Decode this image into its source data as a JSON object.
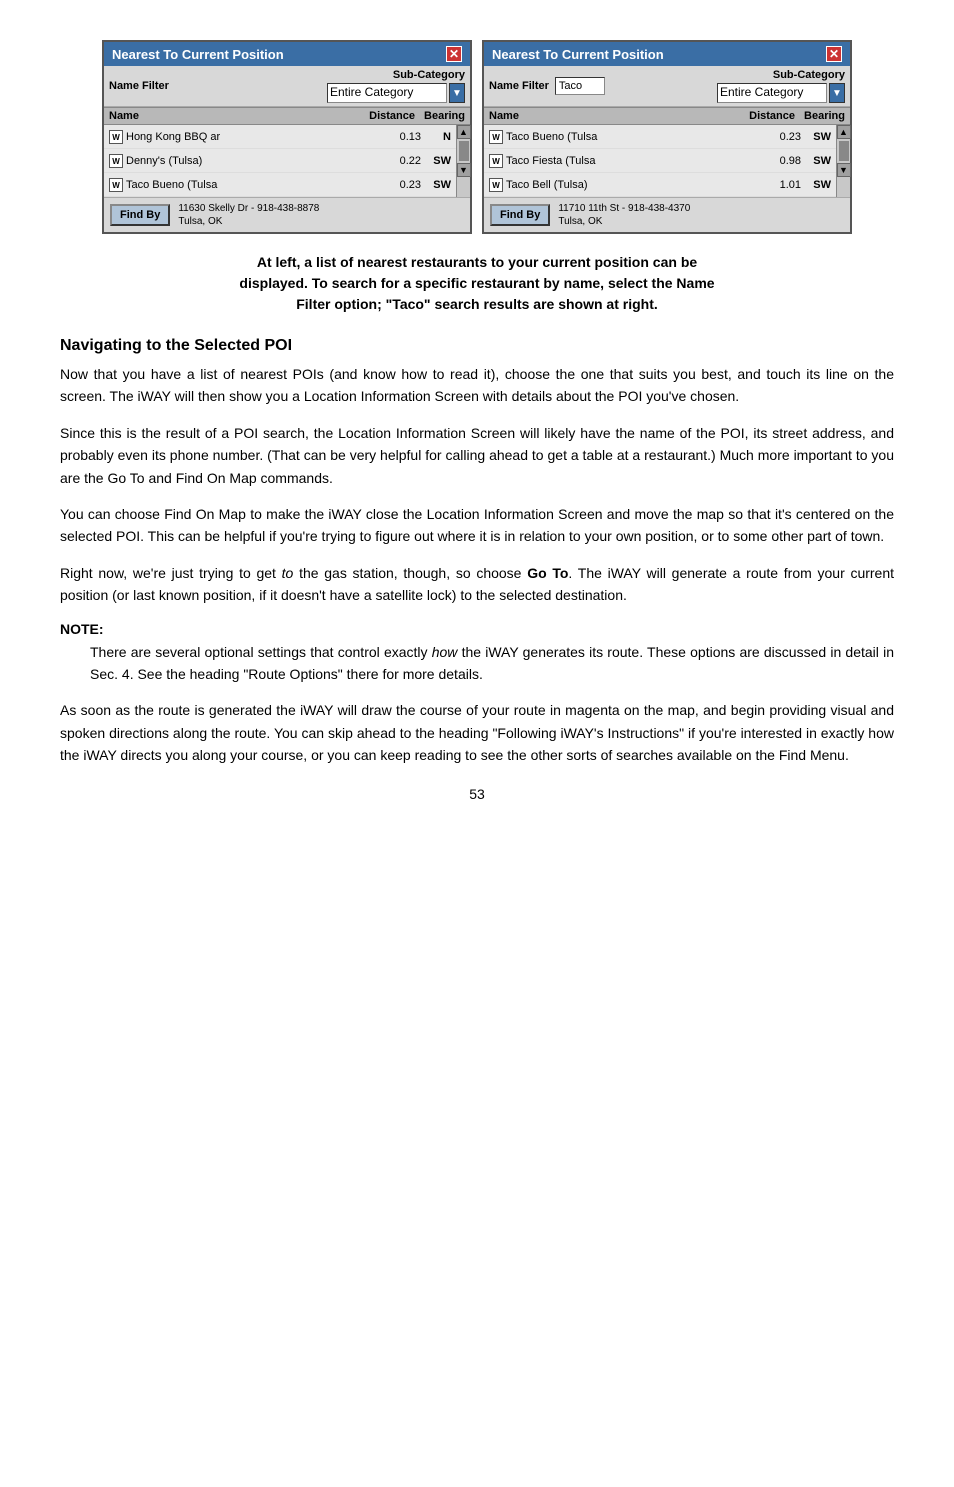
{
  "screenshots": [
    {
      "id": "left",
      "titlebar": "Nearest To Current Position",
      "close_label": "✕",
      "name_filter_label": "Name Filter",
      "name_filter_value": "",
      "subcategory_label": "Sub-Category",
      "subcategory_value": "Entire Category",
      "col_name": "Name",
      "col_distance": "Distance",
      "col_bearing": "Bearing",
      "items": [
        {
          "icon": "W",
          "name": "Hong Kong BBQ ar",
          "dist": "0.13",
          "bearing": "N"
        },
        {
          "icon": "W",
          "name": "Denny's (Tulsa)",
          "dist": "0.22",
          "bearing": "SW"
        },
        {
          "icon": "W",
          "name": "Taco Bueno (Tulsa",
          "dist": "0.23",
          "bearing": "SW"
        }
      ],
      "findby_label": "Find By",
      "address_line1": "11630 Skelly Dr - 918-438-8878",
      "address_line2": "Tulsa, OK"
    },
    {
      "id": "right",
      "titlebar": "Nearest To Current Position",
      "close_label": "✕",
      "name_filter_label": "Name Filter",
      "name_filter_value": "Taco",
      "subcategory_label": "Sub-Category",
      "subcategory_value": "Entire Category",
      "col_name": "Name",
      "col_distance": "Distance",
      "col_bearing": "Bearing",
      "items": [
        {
          "icon": "W",
          "name": "Taco Bueno (Tulsa",
          "dist": "0.23",
          "bearing": "SW"
        },
        {
          "icon": "W",
          "name": "Taco Fiesta (Tulsa",
          "dist": "0.98",
          "bearing": "SW"
        },
        {
          "icon": "W",
          "name": "Taco Bell (Tulsa)",
          "dist": "1.01",
          "bearing": "SW"
        }
      ],
      "findby_label": "Find By",
      "address_line1": "11710 11th St - 918-438-4370",
      "address_line2": "Tulsa, OK"
    }
  ],
  "caption": {
    "line1": "At left, a list of nearest restaurants to your current position can be",
    "line2": "displayed. To search for a specific restaurant by name, select the Name",
    "line3": "Filter option; \"Taco\" search results are shown at right."
  },
  "sections": [
    {
      "heading": "Navigating to the Selected POI",
      "paragraphs": [
        "Now that you have a list of nearest POIs (and know how to read it), choose the one that suits you best, and touch its line on the screen. The iWAY will then show you a Location Information Screen with details about the POI you've chosen.",
        "Since this is the result of a POI search, the Location Information Screen will likely have the name of the POI, its street address, and probably even its phone number. (That can be very helpful for calling ahead to get a table at a restaurant.) Much more important to you are the Go To and Find On Map commands.",
        "You can choose Find On Map to make the iWAY close the Location Information Screen and move the map so that it's centered on the selected POI. This can be helpful if you're trying to figure out where it is in relation to your own position, or to some other part of town.",
        "Right now, we're just trying to get to the gas station, though, so choose Go To. The iWAY will generate a route from your current position (or last known position, if it doesn't have a satellite lock) to the selected destination."
      ],
      "italic_word": "to",
      "bold_phrase": "Go To"
    }
  ],
  "note": {
    "label": "NOTE:",
    "text": "There are several optional settings that control exactly how the iWAY generates its route. These options are discussed in detail in Sec. 4. See the heading \"Route Options\" there for more details.",
    "italic_word": "how"
  },
  "final_paragraph": "As soon as the route is generated the iWAY will draw the course of your route in magenta on the map, and begin providing visual and spoken directions along the route. You can skip ahead to the heading \"Following iWAY's Instructions\" if you're interested in exactly how the iWAY directs you along your course, or you can keep reading to see the other sorts of searches available on the Find Menu.",
  "page_number": "53"
}
